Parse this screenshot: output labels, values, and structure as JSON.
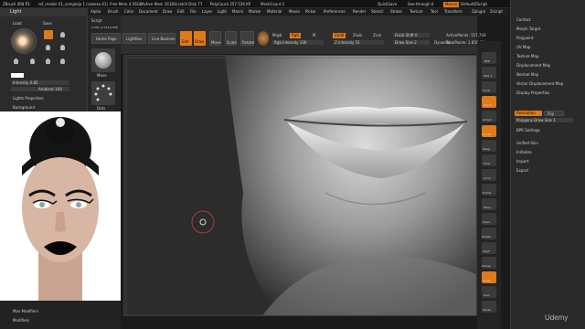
{
  "title_bar": {
    "app": "ZBrush 4R8 P2",
    "file": "ref_render 01_complejo 1 (cabeza 01)",
    "stats": [
      "Free Mem 4.56GB",
      "Active Mem 1618",
      "Scratch Disk 77",
      "PolyCount 257.536 KP",
      "MeshCount 1"
    ],
    "quicksave": "QuickSave",
    "seethrough": "See-through 0",
    "menus": "Menus",
    "default_zscript": "DefaultZScript"
  },
  "menu_bar": [
    "Alpha",
    "Brush",
    "Color",
    "Document",
    "Draw",
    "Edit",
    "File",
    "Layer",
    "Light",
    "Macro",
    "Marker",
    "Material",
    "Movie",
    "Picker",
    "Preferences",
    "Render",
    "Stencil",
    "Stroke",
    "Texture",
    "Tool",
    "Transform",
    "Zplugin",
    "Zscript"
  ],
  "light_panel": {
    "title": "Light",
    "load": "Load",
    "save": "Save",
    "intensity": "Intensity 0.85",
    "ambient": "Ambient 100",
    "lights_properties": "Lights Properties",
    "background": "Background"
  },
  "left_col2": {
    "script": "Script",
    "coords": "0.555,-0.713,0.898",
    "home_page": "Home Page",
    "lightbox": "LightBox",
    "live_boolean": "Live Boolean",
    "brush_label": "Move",
    "stroke_label": "Dots"
  },
  "shelf": {
    "edit": "Edit",
    "draw": "Draw",
    "move": "Move",
    "scale": "Scale",
    "rotate": "Rotate",
    "mrgb": "Mrgb",
    "rgb": "Rgb",
    "m": "M",
    "zadd": "Zadd",
    "zsub": "Zsub",
    "zcut": "Zcut",
    "focal_shift": "Focal Shift 0",
    "draw_size": "Draw Size 2",
    "dynamic": "Dynamic",
    "rgb_intensity": "Rgb Intensity 100",
    "z_intensity": "Z Intensity 51",
    "active_points": "ActivePoints: 157,743",
    "total_points": "TotalPoints: 2.858 Mil"
  },
  "right_tools": [
    "BPR",
    "SPix 3",
    "Scroll",
    "Zoom",
    "Actual",
    "AAHalf",
    "Persp",
    "Floor",
    "Local",
    "Frame",
    "Move",
    "Scale",
    "Rotate",
    "PolyF",
    "Transp",
    "Ghost",
    "Solo",
    "Xpose"
  ],
  "right_panel": {
    "items": [
      "Contact",
      "Morph Target",
      "Polypaint",
      "UV Map",
      "Texture Map",
      "Displacement Map",
      "Normal Map",
      "Vector Displacement Map",
      "Display Properties"
    ],
    "resolution": "Resolution",
    "flip": "Flip",
    "polygons_draw_size": "Polygons Draw Size 1",
    "bpr_settings": "BPR Settings",
    "lower_items": [
      "Unified Skin",
      "Initialize",
      "Import",
      "Export"
    ]
  },
  "left_bottom": {
    "row1": "Max Modifiers",
    "row2": "Modifiers"
  },
  "watermark": "Udemy"
}
